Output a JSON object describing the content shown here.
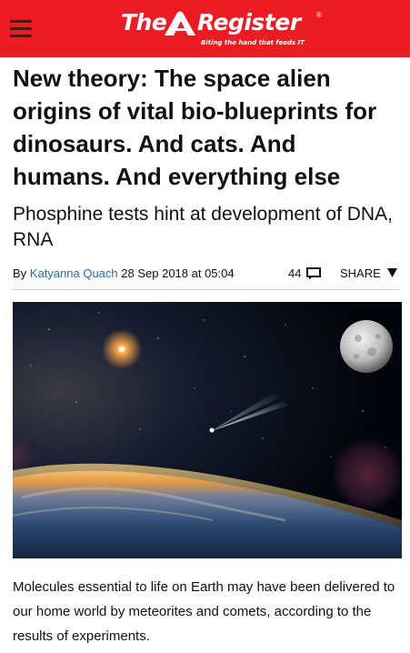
{
  "header": {
    "logo_the": "The",
    "logo_register": "Register",
    "logo_registered": "®",
    "logo_tagline": "Biting the hand that feeds IT",
    "background_color": "#ed1c24",
    "menu_icon": "hamburger-menu-icon"
  },
  "article": {
    "headline": "New theory: The space alien origins of vital bio-blueprints for dinosaurs. And cats. And humans. And everything else",
    "standfirst": "Phosphine tests hint at development of DNA, RNA",
    "byline": {
      "prefix": "By ",
      "author": "Katyanna Quach",
      "date": " 28 Sep 2018 at 05:04",
      "author_color": "#2a6bb5"
    },
    "comments": {
      "count": "44",
      "icon": "comment-bubble-icon"
    },
    "share": {
      "label": "SHARE",
      "icon": "caret-down-icon"
    },
    "hero_image": {
      "description_icon": "space-comet-earth-moon-image"
    },
    "body": "Molecules essential to life on Earth may have been delivered to our home world by meteorites and comets, according to the results of experiments."
  }
}
